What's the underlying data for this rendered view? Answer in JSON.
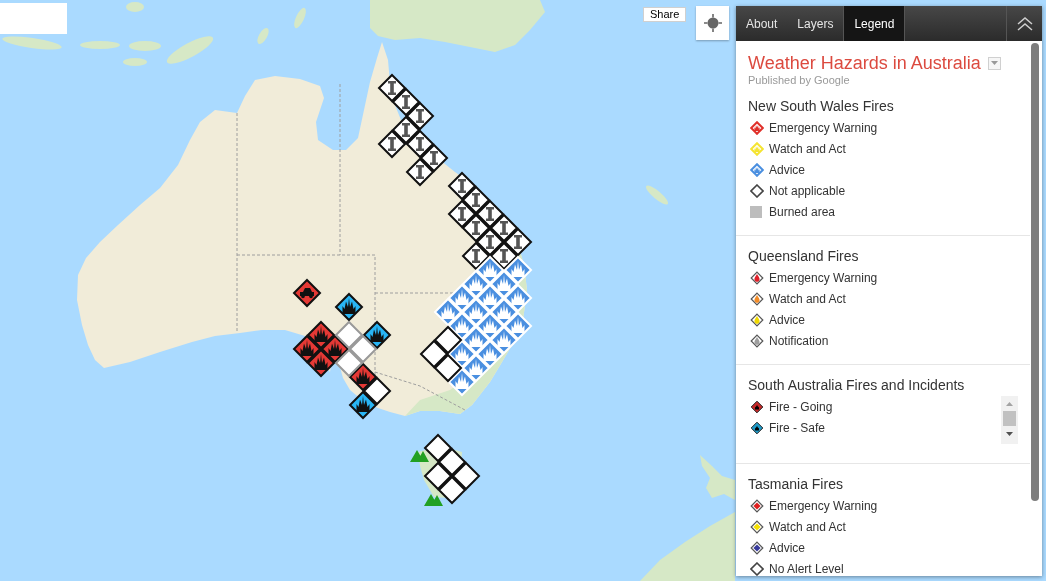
{
  "map": {
    "share_button": "Share"
  },
  "panel": {
    "tabs": [
      {
        "label": "About",
        "selected": false
      },
      {
        "label": "Layers",
        "selected": false
      },
      {
        "label": "Legend",
        "selected": true
      }
    ],
    "title": "Weather Hazards in Australia",
    "publisher": "Published by Google",
    "sections": [
      {
        "heading": "New South Wales Fires",
        "scroll_box": false,
        "items": [
          {
            "label": "Emergency Warning",
            "kind": "flame_outline",
            "color": "#e0302a"
          },
          {
            "label": "Watch and Act",
            "kind": "flame_outline",
            "color": "#f5e431"
          },
          {
            "label": "Advice",
            "kind": "flame_outline",
            "color": "#4a8fe0"
          },
          {
            "label": "Not applicable",
            "kind": "outline",
            "color": "#444444"
          },
          {
            "label": "Burned area",
            "kind": "square",
            "color": "#bdbdbd"
          }
        ]
      },
      {
        "heading": "Queensland Fires",
        "scroll_box": false,
        "items": [
          {
            "label": "Emergency Warning",
            "kind": "drop",
            "color": "#e0202a"
          },
          {
            "label": "Watch and Act",
            "kind": "drop",
            "color": "#f28c28"
          },
          {
            "label": "Advice",
            "kind": "drop",
            "color": "#f0d800"
          },
          {
            "label": "Notification",
            "kind": "drop",
            "color": "#9e9e9e"
          }
        ]
      },
      {
        "heading": "South Australia Fires and Incidents",
        "scroll_box": true,
        "items": [
          {
            "label": "Fire - Going",
            "kind": "flame",
            "color": "#c62828"
          },
          {
            "label": "Fire - Safe",
            "kind": "flame",
            "color": "#1e9ac8"
          }
        ]
      },
      {
        "heading": "Tasmania Fires",
        "scroll_box": false,
        "items": [
          {
            "label": "Emergency Warning",
            "kind": "inner",
            "color": "#e02020"
          },
          {
            "label": "Watch and Act",
            "kind": "inner",
            "color": "#f5e000"
          },
          {
            "label": "Advice",
            "kind": "inner",
            "color": "#36399a"
          },
          {
            "label": "No Alert Level",
            "kind": "outline",
            "color": "#444444"
          }
        ]
      }
    ]
  }
}
